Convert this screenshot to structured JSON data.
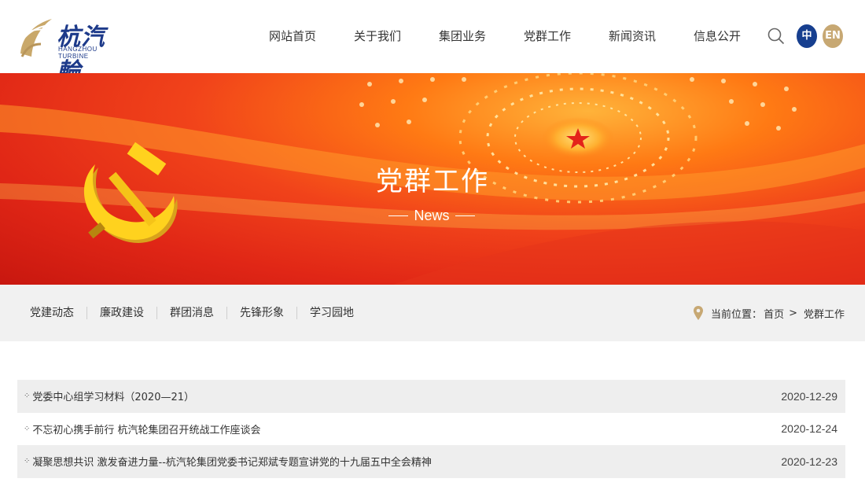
{
  "header": {
    "logo_cn": "杭汽輪",
    "logo_en": "HANGZHOU TURBINE",
    "nav": [
      "网站首页",
      "关于我们",
      "集团业务",
      "党群工作",
      "新闻资讯",
      "信息公开"
    ],
    "lang_cn": "中",
    "lang_en": "EN"
  },
  "banner": {
    "title": "党群工作",
    "subtitle": "News"
  },
  "subnav": [
    "党建动态",
    "廉政建设",
    "群团消息",
    "先锋形象",
    "学习园地"
  ],
  "breadcrumb": {
    "label": "当前位置：",
    "home": "首页",
    "separator": ">",
    "current": "党群工作"
  },
  "list": [
    {
      "title": "党委中心组学习材料（2020—21）",
      "date": "2020-12-29"
    },
    {
      "title": "不忘初心携手前行 杭汽轮集团召开统战工作座谈会",
      "date": "2020-12-24"
    },
    {
      "title": "凝聚思想共识 激发奋进力量--杭汽轮集团党委书记郑斌专题宣讲党的十九届五中全会精神",
      "date": "2020-12-23"
    }
  ],
  "colors": {
    "brand_blue": "#173f8f",
    "brand_gold": "#c7a873",
    "banner_red": "#e02616"
  }
}
